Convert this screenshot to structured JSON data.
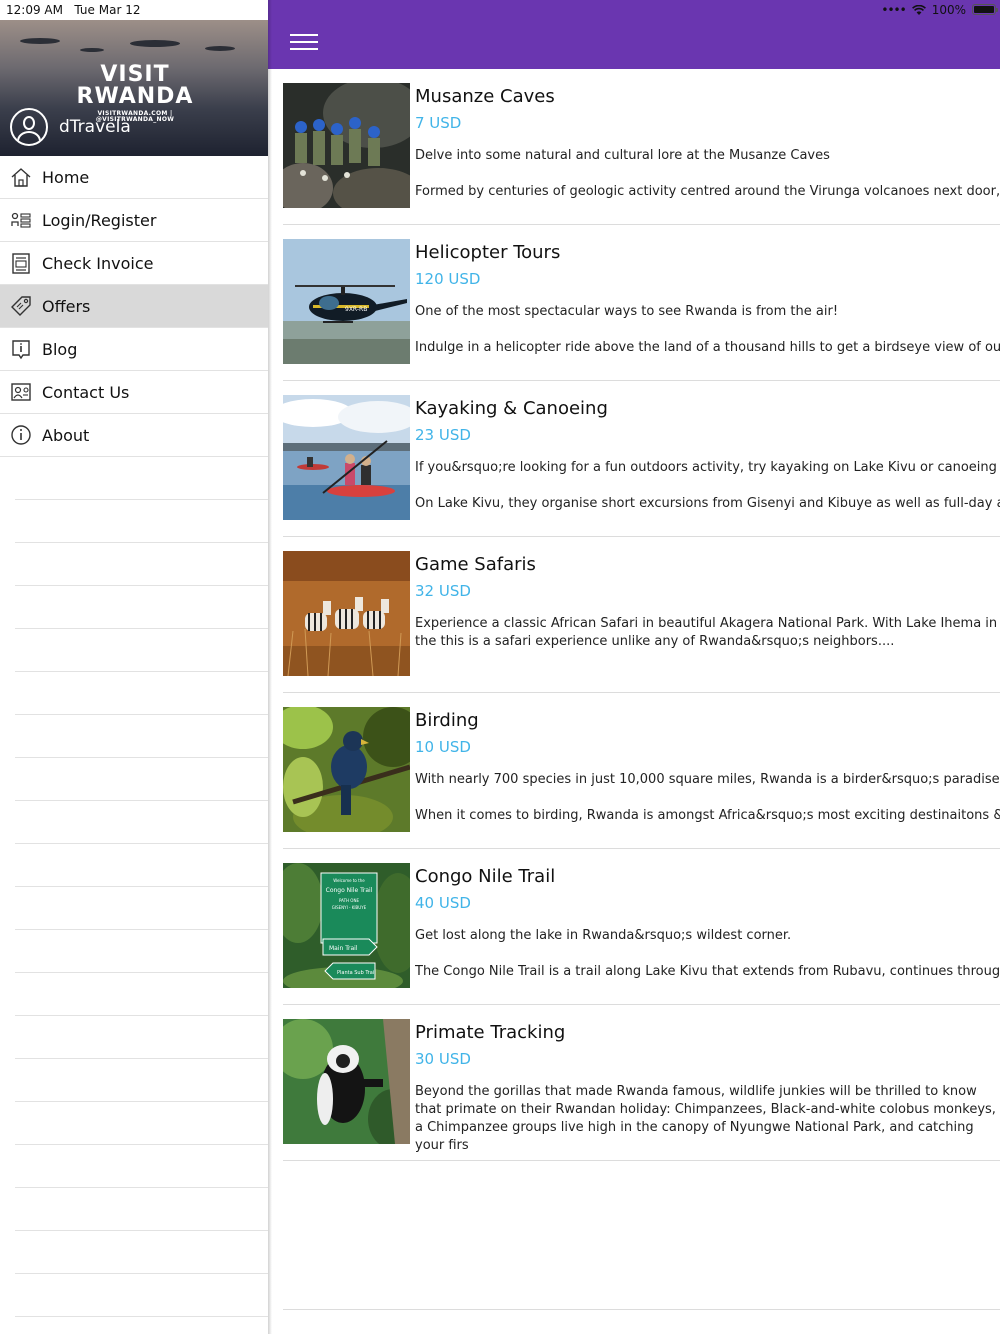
{
  "status_bar": {
    "time": "12:09 AM",
    "date": "Tue Mar 12",
    "battery": "100%"
  },
  "drawer": {
    "logo_line1": "VISIT",
    "logo_line2": "RWANDA",
    "logo_line3": "VISITRWANDA.COM | @VISITRWANDA_NOW",
    "username": "dTravela",
    "items": [
      {
        "label": "Home",
        "icon": "home-icon"
      },
      {
        "label": "Login/Register",
        "icon": "login-icon"
      },
      {
        "label": "Check Invoice",
        "icon": "invoice-icon"
      },
      {
        "label": "Offers",
        "icon": "tag-icon",
        "active": true
      },
      {
        "label": "Blog",
        "icon": "blog-icon"
      },
      {
        "label": "Contact Us",
        "icon": "contact-icon"
      },
      {
        "label": "About",
        "icon": "info-icon"
      }
    ]
  },
  "app_bar": {
    "color": "#6a36b0",
    "menu_icon": "hamburger-menu-icon"
  },
  "offers": [
    {
      "title": "Musanze Caves",
      "price": "7 USD",
      "desc1": "Delve into some natural and cultural lore at the Musanze Caves",
      "desc2": "Formed by centuries of geologic activity centred around the Virunga volcanoes next door, the"
    },
    {
      "title": "Helicopter Tours",
      "price": "120 USD",
      "desc1": "One of the most spectacular ways to see Rwanda is from the air!",
      "desc2": "Indulge in a helicopter ride above the land of a thousand hills to get a birdseye view of our e"
    },
    {
      "title": "Kayaking & Canoeing",
      "price": "23 USD",
      "desc1": "If you&rsquo;re looking for a fun outdoors activity, try kayaking on Lake Kivu or canoeing nea",
      "desc2": "On Lake Kivu, they organise short excursions from Gisenyi and Kibuye as well as full-day and"
    },
    {
      "title": "Game Safaris",
      "price": "32 USD",
      "desc1": "Experience a classic African Safari in beautiful Akagera National Park. With Lake Ihema in the this is a safari experience unlike any of Rwanda&rsquo;s neighbors....",
      "desc2": ""
    },
    {
      "title": "Birding",
      "price": "10 USD",
      "desc1": "With nearly 700 species in just 10,000 square miles, Rwanda is a birder&rsquo;s paradise.",
      "desc2": "When it comes to birding, Rwanda is amongst Africa&rsquo;s most exciting destinaitons &nc"
    },
    {
      "title": "Congo Nile Trail",
      "price": "40 USD",
      "desc1": "Get lost along the lake in Rwanda&rsquo;s wildest corner.",
      "desc2": "The Congo Nile Trail is a trail along Lake Kivu that extends from Rubavu, continues through R"
    },
    {
      "title": "Primate Tracking",
      "price": "30 USD",
      "desc1": "Beyond the gorillas that made Rwanda famous, wildlife junkies will be thrilled to know that primate on their Rwandan holiday: Chimpanzees, Black-and-white colobus monkeys, a Chimpanzee groups live high in the canopy of Nyungwe National Park, and catching your firs",
      "desc2": ""
    }
  ],
  "sign_text": {
    "line1": "Welcome to the",
    "line2": "Congo Nile Trail",
    "line3": "PATH ONE",
    "line4": "GISENYI - KIBUYE",
    "arrow1": "Main Trail",
    "arrow2": "Planta Sub Trail"
  },
  "heli_reg": "9XR-RB"
}
